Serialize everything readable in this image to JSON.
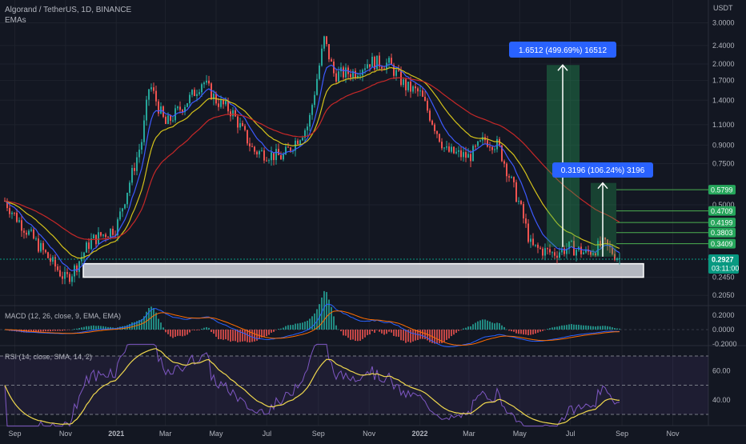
{
  "header": {
    "symbol_title": "Algorand / TetherUS, 1D, BINANCE",
    "indicator": "EMAs",
    "currency": "USDT"
  },
  "colors": {
    "background": "#131722",
    "grid": "#1e222d",
    "text": "#b2b5be",
    "candle_up": "#26a69a",
    "candle_down": "#ef5350",
    "ema_fast": "#3d5afe",
    "ema_mid": "#d4c21a",
    "ema_slow": "#c62828",
    "label_blue": "#2962ff",
    "target_green": "#26a65b",
    "price_green": "#089981"
  },
  "chart_data": [
    {
      "type": "line",
      "name": "price",
      "y_axis_ticks": [
        "3.0000",
        "2.4000",
        "2.0000",
        "1.7000",
        "1.4000",
        "1.1000",
        "0.9000",
        "0.7500",
        "0.5000",
        "0.2450",
        "0.2050"
      ],
      "x_axis_ticks": [
        "Sep",
        "Nov",
        "2021",
        "Mar",
        "May",
        "Jul",
        "Sep",
        "Nov",
        "2022",
        "Mar",
        "May",
        "Jul",
        "Sep",
        "Nov"
      ],
      "log_scale": true,
      "ylim": [
        0.19,
        3.3
      ],
      "x_start": "2020-08-20",
      "x_end": "2022-08-30",
      "series": [
        {
          "x": [
            "2020-08-20",
            "2020-09-01",
            "2020-10-01",
            "2020-11-01",
            "2020-11-10",
            "2020-12-01",
            "2021-01-01",
            "2021-02-01",
            "2021-02-10",
            "2021-03-01",
            "2021-04-01",
            "2021-04-15",
            "2021-05-01",
            "2021-05-20",
            "2021-06-15",
            "2021-07-20",
            "2021-08-20",
            "2021-09-08",
            "2021-09-20",
            "2021-10-15",
            "2021-11-01",
            "2021-11-25",
            "2021-12-15",
            "2022-01-01",
            "2022-02-01",
            "2022-03-01",
            "2022-03-20",
            "2022-04-05",
            "2022-05-01",
            "2022-05-15",
            "2022-06-10",
            "2022-07-01",
            "2022-07-20",
            "2022-08-10",
            "2022-08-30"
          ],
          "values": [
            0.52,
            0.45,
            0.33,
            0.24,
            0.26,
            0.35,
            0.4,
            0.95,
            1.65,
            1.1,
            1.45,
            1.7,
            1.4,
            1.25,
            0.85,
            0.8,
            1.1,
            2.55,
            1.8,
            1.85,
            2.05,
            2.0,
            1.6,
            1.5,
            0.85,
            0.8,
            0.95,
            0.9,
            0.5,
            0.33,
            0.31,
            0.33,
            0.31,
            0.34,
            0.2927
          ]
        }
      ],
      "annotations": [
        {
          "text": "1.6512 (499.69%) 16512",
          "from": 0.33,
          "to": 1.98
        },
        {
          "text": "0.3196 (106.24%) 3196",
          "from": 0.3,
          "to": 0.62
        }
      ],
      "support_zone": [
        0.245,
        0.28
      ],
      "target_levels": [
        "0.5799",
        "0.4709",
        "0.4199",
        "0.3803",
        "0.3409"
      ],
      "current_price": "0.2927",
      "countdown": "03:11:00"
    },
    {
      "type": "line",
      "name": "MACD",
      "title": "MACD (12, 26, close, 9, EMA, EMA)",
      "y_axis_ticks": [
        "0.2000",
        "0.0000",
        "-0.2000"
      ]
    },
    {
      "type": "line",
      "name": "RSI",
      "title": "RSI (14, close, SMA, 14, 2)",
      "y_axis_ticks": [
        "60.00",
        "40.00"
      ]
    }
  ]
}
